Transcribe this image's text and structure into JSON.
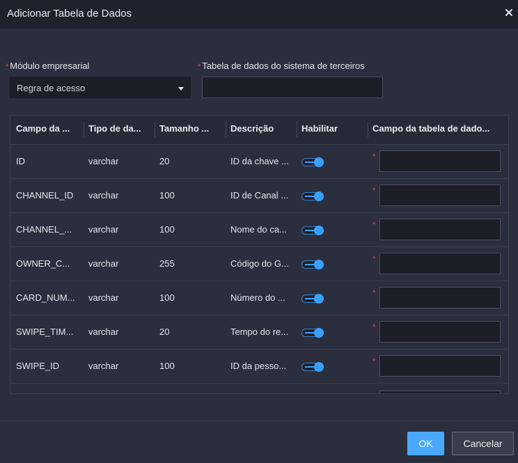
{
  "dialog": {
    "title": "Adicionar Tabela de Dados",
    "close_icon": "close-icon"
  },
  "form": {
    "module_label": "Módulo empresarial",
    "module_value": "Regra de acesso",
    "third_party_label": "Tabela de dados do sistema de terceiros",
    "third_party_value": "",
    "required_mark": "*"
  },
  "table": {
    "headers": [
      "Campo da ...",
      "Tipo de da...",
      "Tamanho ...",
      "Descrição",
      "Habilitar",
      "Campo da tabela de dado..."
    ],
    "rows": [
      {
        "field": "ID",
        "type": "varchar",
        "size": "20",
        "description": "ID da chave ...",
        "enabled": true,
        "mapped": ""
      },
      {
        "field": "CHANNEL_ID",
        "type": "varchar",
        "size": "100",
        "description": "ID de Canal ...",
        "enabled": true,
        "mapped": ""
      },
      {
        "field": "CHANNEL_...",
        "type": "varchar",
        "size": "100",
        "description": "Nome do ca...",
        "enabled": true,
        "mapped": ""
      },
      {
        "field": "OWNER_C...",
        "type": "varchar",
        "size": "255",
        "description": "Código do G...",
        "enabled": true,
        "mapped": ""
      },
      {
        "field": "CARD_NUM...",
        "type": "varchar",
        "size": "100",
        "description": "Número do ...",
        "enabled": true,
        "mapped": ""
      },
      {
        "field": "SWIPE_TIM...",
        "type": "varchar",
        "size": "20",
        "description": "Tempo do re...",
        "enabled": true,
        "mapped": ""
      },
      {
        "field": "SWIPE_ID",
        "type": "varchar",
        "size": "100",
        "description": "ID da pesso...",
        "enabled": true,
        "mapped": ""
      }
    ]
  },
  "footer": {
    "ok_label": "OK",
    "cancel_label": "Cancelar"
  },
  "colors": {
    "accent": "#4aa8ff",
    "required": "#e5484d",
    "background": "#2b2f3d"
  }
}
